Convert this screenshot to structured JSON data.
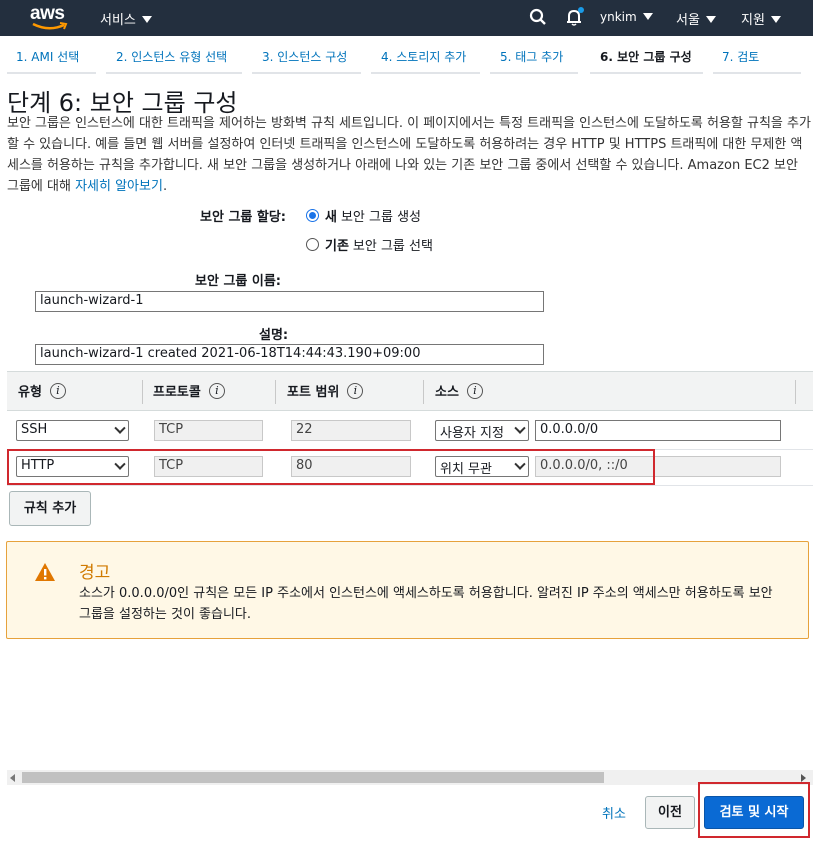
{
  "topnav": {
    "logo": "aws",
    "services": "서비스",
    "user": "ynkim",
    "region": "서울",
    "support": "지원",
    "search_icon": "search-icon",
    "bell_icon": "bell-icon"
  },
  "steps": [
    {
      "label": "1. AMI 선택"
    },
    {
      "label": "2. 인스턴스 유형 선택"
    },
    {
      "label": "3. 인스턴스 구성"
    },
    {
      "label": "4. 스토리지 추가"
    },
    {
      "label": "5. 태그 추가"
    },
    {
      "label": "6. 보안 그룹 구성"
    },
    {
      "label": "7. 검토"
    }
  ],
  "page": {
    "title": "단계 6: 보안 그룹 구성",
    "description": "보안 그룹은 인스턴스에 대한 트래픽을 제어하는 방화벽 규칙 세트입니다. 이 페이지에서는 특정 트래픽을 인스턴스에 도달하도록 허용할 규칙을 추가할 수 있습니다. 예를 들면 웹 서버를 설정하여 인터넷 트래픽을 인스턴스에 도달하도록 허용하려는 경우 HTTP 및 HTTPS 트래픽에 대한 무제한 액세스를 허용하는 규칙을 추가합니다. 새 보안 그룹을 생성하거나 아래에 나와 있는 기존 보안 그룹 중에서 선택할 수 있습니다. Amazon EC2 보안 그룹에 대해",
    "learn_more": "자세히 알아보기",
    "desc_end": "."
  },
  "assign": {
    "label": "보안 그룹 할당:",
    "option_new_bold": "새",
    "option_new_rest": "보안 그룹 생성",
    "option_existing_bold": "기존",
    "option_existing_rest": "보안 그룹 선택"
  },
  "group_name": {
    "label": "보안 그룹 이름:",
    "value": "launch-wizard-1"
  },
  "group_desc": {
    "label": "설명:",
    "value": "launch-wizard-1 created 2021-06-18T14:44:43.190+09:00"
  },
  "table": {
    "headers": [
      "유형",
      "프로토콜",
      "포트 범위",
      "소스"
    ],
    "info_glyph": "i",
    "rows": [
      {
        "type": "SSH",
        "protocol": "TCP",
        "port": "22",
        "source": "사용자 지정",
        "cidr": "0.0.0.0/0"
      },
      {
        "type": "HTTP",
        "protocol": "TCP",
        "port": "80",
        "source": "위치 무관",
        "cidr": "0.0.0.0/0, ::/0"
      }
    ]
  },
  "add_rule_button": "규칙 추가",
  "warning": {
    "title": "경고",
    "text": "소스가 0.0.0.0/0인 규칙은 모든 IP 주소에서 인스턴스에 액세스하도록 허용합니다. 알려진 IP 주소의 액세스만 허용하도록 보안 그룹을 설정하는 것이 좋습니다.",
    "color": "#d07a00"
  },
  "footer": {
    "cancel": "취소",
    "previous": "이전",
    "review_launch": "검토 및 시작"
  },
  "colors": {
    "nav_bg": "#232f3e",
    "link": "#0073bb",
    "primary": "#0a6ad4",
    "highlight": "#d0282e"
  }
}
